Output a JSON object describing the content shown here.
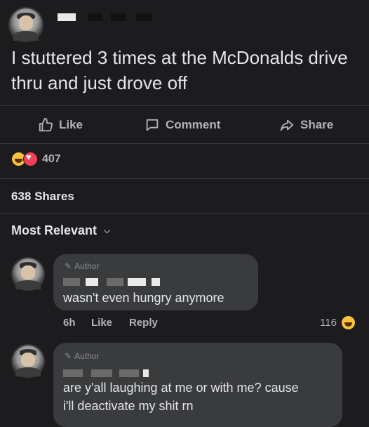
{
  "post": {
    "text": "I stuttered 3 times at the McDonalds drive thru and just drove off"
  },
  "actions": {
    "like": "Like",
    "comment": "Comment",
    "share": "Share"
  },
  "reactions": {
    "count": "407",
    "types": [
      "haha-icon",
      "love-icon"
    ]
  },
  "shares": "638 Shares",
  "sort": {
    "label": "Most Relevant"
  },
  "comments": [
    {
      "badge": "Author",
      "text": "wasn't even hungry anymore",
      "time": "6h",
      "like": "Like",
      "reply": "Reply",
      "reaction_count": "116"
    },
    {
      "badge": "Author",
      "text_line1": "are y'all laughing at me or with me? cause",
      "text_line2": "i'll deactivate my shit rn"
    }
  ],
  "colors": {
    "background": "#1c1c1e",
    "bubble": "#3a3b3c",
    "text": "#e4e6eb",
    "muted": "#b0b3b8"
  }
}
